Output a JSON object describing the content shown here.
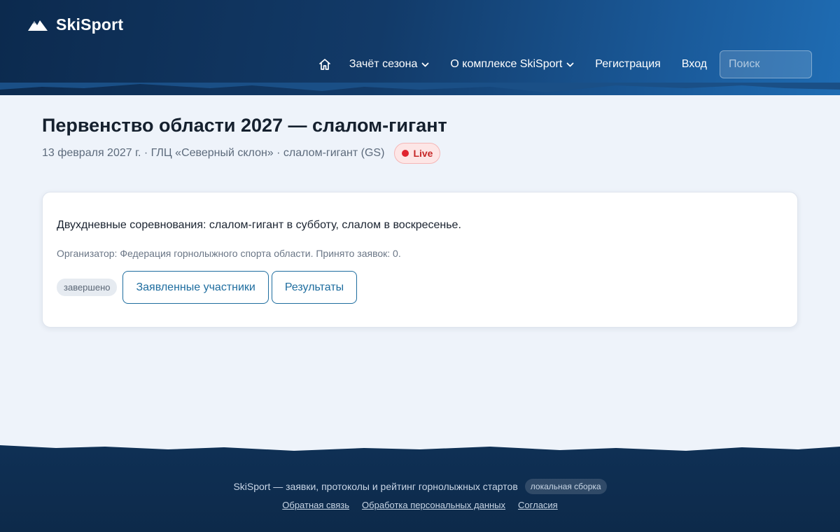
{
  "brand": {
    "name": "SkiSport",
    "icon": "mountain-icon"
  },
  "nav": {
    "home_icon": "home-icon",
    "items": [
      {
        "label": "Зачёт сезона",
        "dropdown": true
      },
      {
        "label": "О комплексе SkiSport",
        "dropdown": true
      },
      {
        "label": "Регистрация",
        "dropdown": false
      },
      {
        "label": "Вход",
        "dropdown": false
      }
    ],
    "search_placeholder": "Поиск"
  },
  "event": {
    "title": "Первенство области 2027 — слалом-гигант",
    "meta": "13 февраля 2027 г. · ГЛЦ «Северный склон» · слалом-гигант (GS)",
    "live_label": "Live",
    "description": "Двухдневные соревнования: слалом-гигант в субботу, слалом в воскресенье.",
    "organizer": "Организатор: Федерация горнолыжного спорта области. Принято заявок: 0.",
    "status": "завершено",
    "buttons": {
      "participants": "Заявленные участники",
      "results": "Результаты"
    }
  },
  "footer": {
    "text": "SkiSport — заявки, протоколы и рейтинг горнолыжных стартов",
    "badge": "локальная сборка",
    "links": [
      "Обратная связь",
      "Обработка персональных данных",
      "Согласия"
    ]
  },
  "colors": {
    "header_dark": "#0c2a4e",
    "header_light": "#1f6cb3",
    "page_bg": "#eef3fa",
    "accent": "#1e6d9f",
    "live_red": "#e0242f"
  }
}
